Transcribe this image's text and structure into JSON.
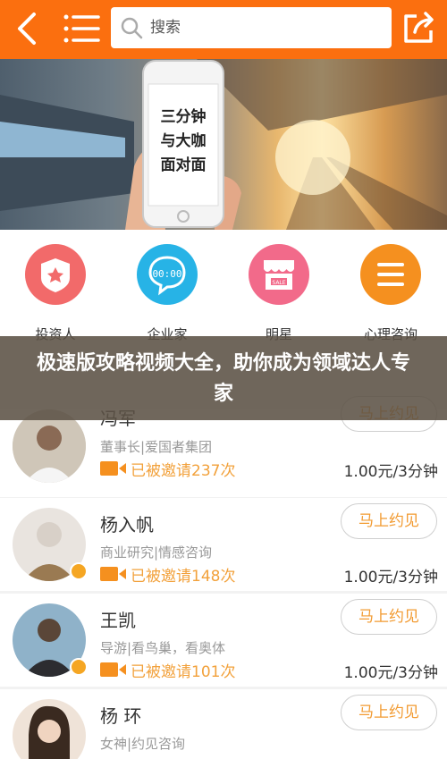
{
  "search": {
    "placeholder": "搜索"
  },
  "categories": [
    {
      "label": "投资人",
      "icon": "police-badge-icon",
      "color": "#f26a6a"
    },
    {
      "label": "企业家",
      "icon": "chat-bubble-icon",
      "color": "#27b3e6"
    },
    {
      "label": "明星",
      "icon": "sale-store-icon",
      "color": "#f26a8a"
    },
    {
      "label": "心理咨询",
      "icon": "menu-lines-icon",
      "color": "#f5901f"
    }
  ],
  "banner": {
    "phone_text": [
      "三分钟",
      "与大咖",
      "面对面"
    ]
  },
  "headline": "极速版攻略视频大全，助你成为领域达人专家",
  "experts": [
    {
      "name": "冯军",
      "title": "董事长|爱国者集团",
      "invite": "已被邀请237次",
      "price": "1.00元/3分钟",
      "button": "马上约见"
    },
    {
      "name": "杨入帆",
      "title": "商业研究|情感咨询",
      "invite": "已被邀请148次",
      "price": "1.00元/3分钟",
      "button": "马上约见"
    },
    {
      "name": "王凯",
      "title": "导游|看鸟巢，看奥体",
      "invite": "已被邀请101次",
      "price": "1.00元/3分钟",
      "button": "马上约见"
    },
    {
      "name": "杨 环",
      "title": "女神|约见咨询",
      "invite": "",
      "price": "",
      "button": "马上约见"
    }
  ],
  "colors": {
    "accent": "#fb6f0f",
    "invite": "#f2a13b",
    "button_text": "#f29b32"
  }
}
